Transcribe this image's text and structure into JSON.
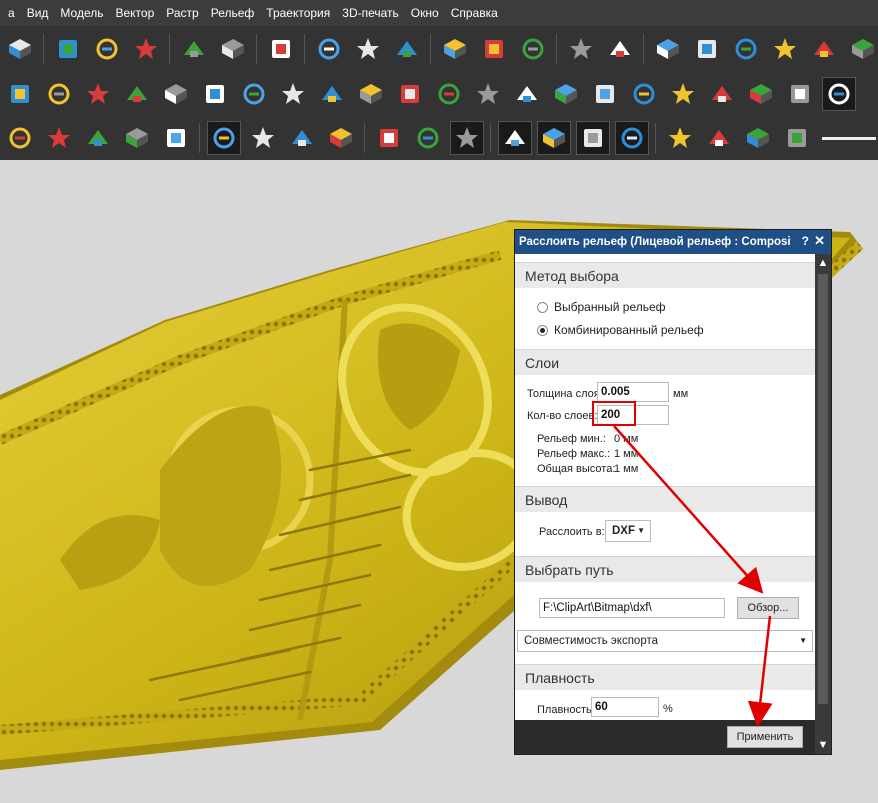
{
  "menu": [
    "а",
    "Вид",
    "Модель",
    "Вектор",
    "Растр",
    "Рельеф",
    "Траектория",
    "3D-печать",
    "Окно",
    "Справка"
  ],
  "toolbar_icons": {
    "row1": [
      "save-icon",
      "cut-icon",
      "copy-icon",
      "paste-icon",
      "undo-icon",
      "redo-icon",
      "notes-icon",
      "scale-icon",
      "mirror-icon",
      "tile-icon",
      "clipart-icon",
      "job-setup-icon",
      "model-tools-icon",
      "machine-icon",
      "layers-icon",
      "folder-star-icon",
      "vector-trace-icon",
      "node-edit-icon",
      "curve-icon",
      "star-shape-icon",
      "relief-green-icon"
    ],
    "row2": [
      "relief-blue-icon",
      "twist-icon",
      "extrude-icon",
      "arrows-icon",
      "weave-icon",
      "bevel-icon",
      "texture-icon",
      "star-folder-icon",
      "plane-icon",
      "wedge-icon",
      "gold-texture-icon",
      "layer-up-icon",
      "layer-stack-icon",
      "gem-icon",
      "slice-icon",
      "slice-dark-icon",
      "smooth-icon",
      "sculpt-icon",
      "blue-surface-icon",
      "cross-icon",
      "flat-relief-icon",
      "layered-relief-icon"
    ],
    "row3": [
      "cube-white-icon",
      "cube-outline-icon",
      "cube-iso-icon",
      "zoom-icon",
      "bulb-icon",
      "render-icon",
      "axes-icon",
      "puzzle-icon",
      "cylinder-icon",
      "box-dark-icon",
      "box-frame-icon",
      "clock-icon",
      "star-blue-icon",
      "stack-blue-icon",
      "stack-red-icon",
      "gold-plane-icon",
      "shapes-green-icon",
      "star-search-icon",
      "pyramid-icon",
      "rainbow-icon"
    ]
  },
  "dialog": {
    "title": "Расслоить рельеф (Лицевой рельеф : Composite ...",
    "help_label": "?",
    "close_label": "✕",
    "selection_method": {
      "header": "Метод выбора",
      "options": [
        "Выбранный рельеф",
        "Комбинированный рельеф"
      ],
      "selected_index": 1
    },
    "layers": {
      "header": "Слои",
      "thickness_label": "Толщина слоя:",
      "thickness_value": "0.005",
      "thickness_unit": "мм",
      "count_label": "Кол-во слоев:",
      "count_value": "200",
      "stats": [
        {
          "label": "Рельеф мин.:",
          "value": "0 мм"
        },
        {
          "label": "Рельеф макс.:",
          "value": "1 мм"
        },
        {
          "label": "Общая высота:",
          "value": "1 мм"
        }
      ]
    },
    "output": {
      "header": "Вывод",
      "slice_to_label": "Расслоить в:",
      "slice_to_value": "DXF"
    },
    "path": {
      "header": "Выбрать путь",
      "path_value": "F:\\ClipArt\\Bitmap\\dxf\\",
      "browse_label": "Обзор...",
      "compat_label": "Совместимость экспорта"
    },
    "smoothness": {
      "header": "Плавность",
      "label": "Плавность",
      "value": "60",
      "unit": "%"
    },
    "apply_label": "Применить"
  },
  "colors": {
    "relief": "#cdb517",
    "annotation": "#e10000",
    "title_bar": "#1f4f86"
  }
}
